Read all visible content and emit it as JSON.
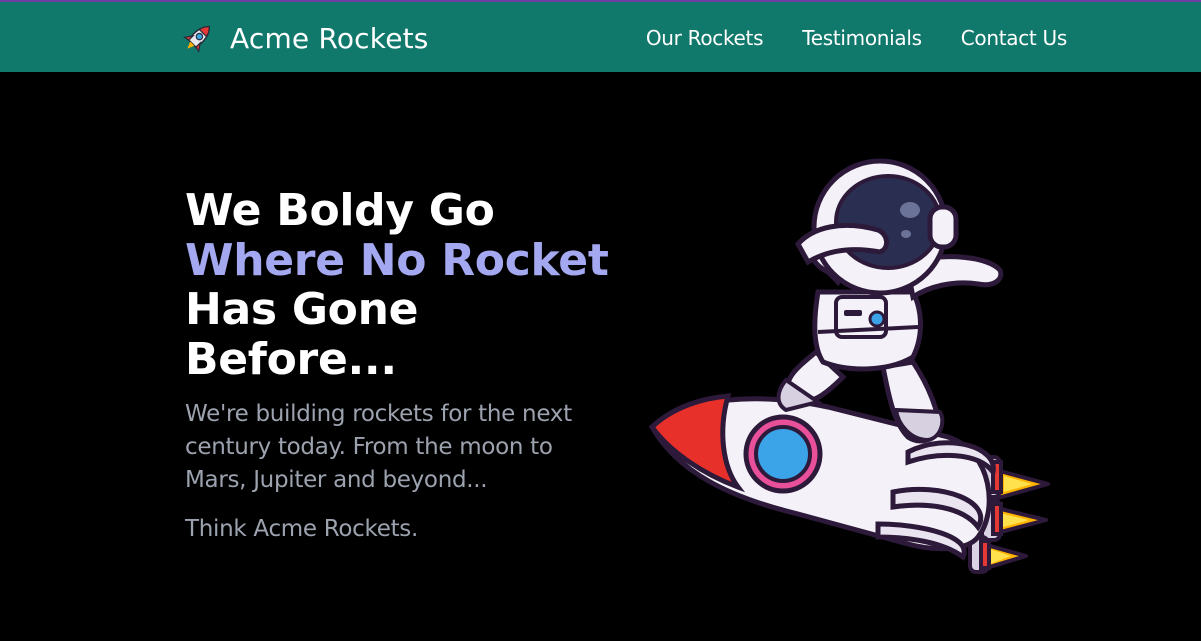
{
  "header": {
    "brand": "Acme Rockets",
    "logo_icon": "rocket-icon",
    "background_color": "#11786c",
    "nav": [
      {
        "label": "Our Rockets"
      },
      {
        "label": "Testimonials"
      },
      {
        "label": "Contact Us"
      }
    ]
  },
  "hero": {
    "heading_line1": "We Boldy Go",
    "heading_line2": "Where No Rocket",
    "heading_line3": "Has Gone",
    "heading_line4": "Before...",
    "accent_color": "#a3a8f0",
    "lead": "We're building rockets for the next century today. From the moon to Mars, Jupiter and beyond...",
    "tagline": "Think Acme Rockets.",
    "illustration_icon": "astronaut-on-rocket-illustration"
  }
}
